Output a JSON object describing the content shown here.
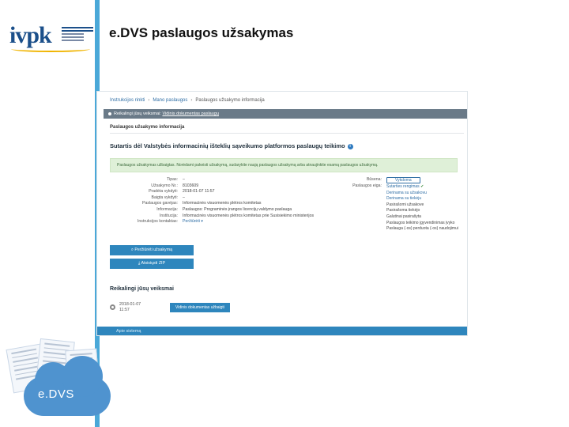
{
  "slide": {
    "title": "e.DVS paslaugos užsakymas",
    "logo_text": "ivpk",
    "illustration_label": "e.DVS"
  },
  "screen": {
    "breadcrumbs": [
      "Instrukcijos rinkti",
      "Mano paslaugos",
      "Paslaugos užsakymo informacija"
    ],
    "banner": {
      "prefix": "Reikalingi jūsų veiksmai:",
      "link": "Vidinis dokumentas paslaugų"
    },
    "section_label": "Paslaugos užsakymo informacija",
    "service_title": "Sutartis dėl Valstybės informacinių išteklių sąveikumo platformos paslaugų teikimo",
    "alert_text": "Paslaugos užsakymas užbaigtas. Norėdami pakeisti užsakymą, sudarykite naują paslaugos užsakymą arba atnaujinkite esamą paslaugos užsakymą.",
    "fields": [
      {
        "label": "Tipas:",
        "value": "–"
      },
      {
        "label": "Užsakymo Nr.:",
        "value": "8103609"
      },
      {
        "label": "Pradėta vykdyti:",
        "value": "2018-01-07 11:57"
      },
      {
        "label": "Baigta vykdyti:",
        "value": "–"
      },
      {
        "label": "Paslaugos gavėjas:",
        "value": "Informacinės visuomenės plėtros komitetas"
      },
      {
        "label": "Informacija:",
        "value": "Paslaugos: Programinės įrangos licencijų valdymo paslauga"
      },
      {
        "label": "Institucija:",
        "value": "Informacinės visuomenės plėtros komitetas prie Susisiekimo ministerijos"
      },
      {
        "label": "Instrukcijos kontaktas:",
        "value": "Peržiūrėti"
      }
    ],
    "status_labels": [
      "Būsena:",
      "Paslaugos eiga:"
    ],
    "status_pill": "Vykdoma",
    "status_steps": [
      {
        "text": "Sutarties rengimas",
        "state": "done"
      },
      {
        "text": "Derinama su užsakovu",
        "state": "active"
      },
      {
        "text": "Derinama su tiekėju",
        "state": "active"
      },
      {
        "text": "Pasirašomi užsakove",
        "state": "pending"
      },
      {
        "text": "Pasirašoma tiekėjo",
        "state": "pending"
      },
      {
        "text": "Galutinai pasirašyta",
        "state": "pending"
      },
      {
        "text": "Paslaugos teikimo įgyvendinimas įvyko",
        "state": "pending"
      },
      {
        "text": "Paslauga (-os) perduota (-os) naudojimui",
        "state": "pending"
      }
    ],
    "buttons": {
      "view_order": "Peržiūrėti užsakymą",
      "download_zip": "Atsisiųsti ZIP"
    },
    "actions": {
      "title": "Reikalingi jūsų veiksmai",
      "date": "2018-01-07 11:57",
      "button": "Vidinis dokumentas užbaigti"
    },
    "footer_text": "Apie sistemą"
  }
}
